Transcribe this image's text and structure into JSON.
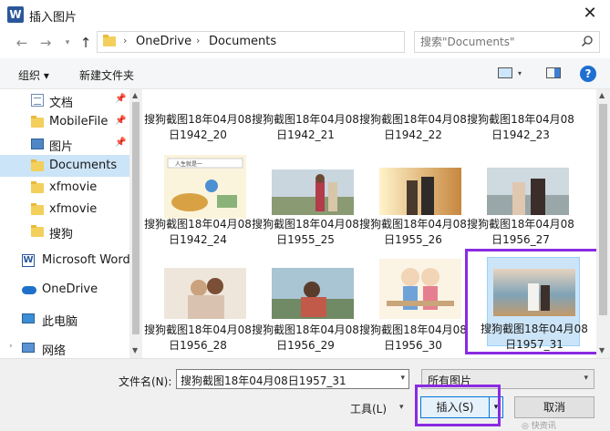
{
  "window": {
    "title": "插入图片",
    "app_icon": "W"
  },
  "address": {
    "crumbs": [
      "OneDrive",
      "Documents"
    ],
    "search_placeholder": "搜索\"Documents\""
  },
  "toolbar": {
    "organize": "组织 ▾",
    "new_folder": "新建文件夹"
  },
  "sidebar": {
    "items": [
      {
        "label": "文档",
        "icon": "document-icon",
        "pinned": true
      },
      {
        "label": "MobileFile",
        "icon": "folder-icon",
        "pinned": true
      },
      {
        "label": "图片",
        "icon": "pictures-icon",
        "pinned": true
      },
      {
        "label": "Documents",
        "icon": "folder-icon",
        "selected": true
      },
      {
        "label": "xfmovie",
        "icon": "folder-icon"
      },
      {
        "label": "xfmovie",
        "icon": "folder-icon"
      },
      {
        "label": "搜狗",
        "icon": "folder-icon"
      },
      {
        "label": "Microsoft Word",
        "icon": "word-icon"
      },
      {
        "label": "OneDrive",
        "icon": "onedrive-icon"
      },
      {
        "label": "此电脑",
        "icon": "this-pc-icon"
      },
      {
        "label": "网络",
        "icon": "network-icon"
      }
    ]
  },
  "files": [
    {
      "name": "搜狗截图18年04月08日1942_20"
    },
    {
      "name": "搜狗截图18年04月08日1942_21"
    },
    {
      "name": "搜狗截图18年04月08日1942_22"
    },
    {
      "name": "搜狗截图18年04月08日1942_23"
    },
    {
      "name": "搜狗截图18年04月08日1942_24",
      "thumb_text": "人生就是一"
    },
    {
      "name": "搜狗截图18年04月08日1955_25"
    },
    {
      "name": "搜狗截图18年04月08日1955_26"
    },
    {
      "name": "搜狗截图18年04月08日1956_27"
    },
    {
      "name": "搜狗截图18年04月08日1956_28"
    },
    {
      "name": "搜狗截图18年04月08日1956_29"
    },
    {
      "name": "搜狗截图18年04月08日1956_30"
    },
    {
      "name": "搜狗截图18年04月08日1957_31",
      "selected": true
    }
  ],
  "bottom": {
    "filename_label": "文件名(N):",
    "filename_value": "搜狗截图18年04月08日1957_31",
    "filetype": "所有图片",
    "tools": "工具(L)",
    "insert": "插入(S)",
    "cancel": "取消"
  },
  "watermark": "◎ 快资讯",
  "colors": {
    "accent": "#0078d7",
    "highlight_frame": "#8a2be2",
    "selection": "#cce4f7"
  }
}
